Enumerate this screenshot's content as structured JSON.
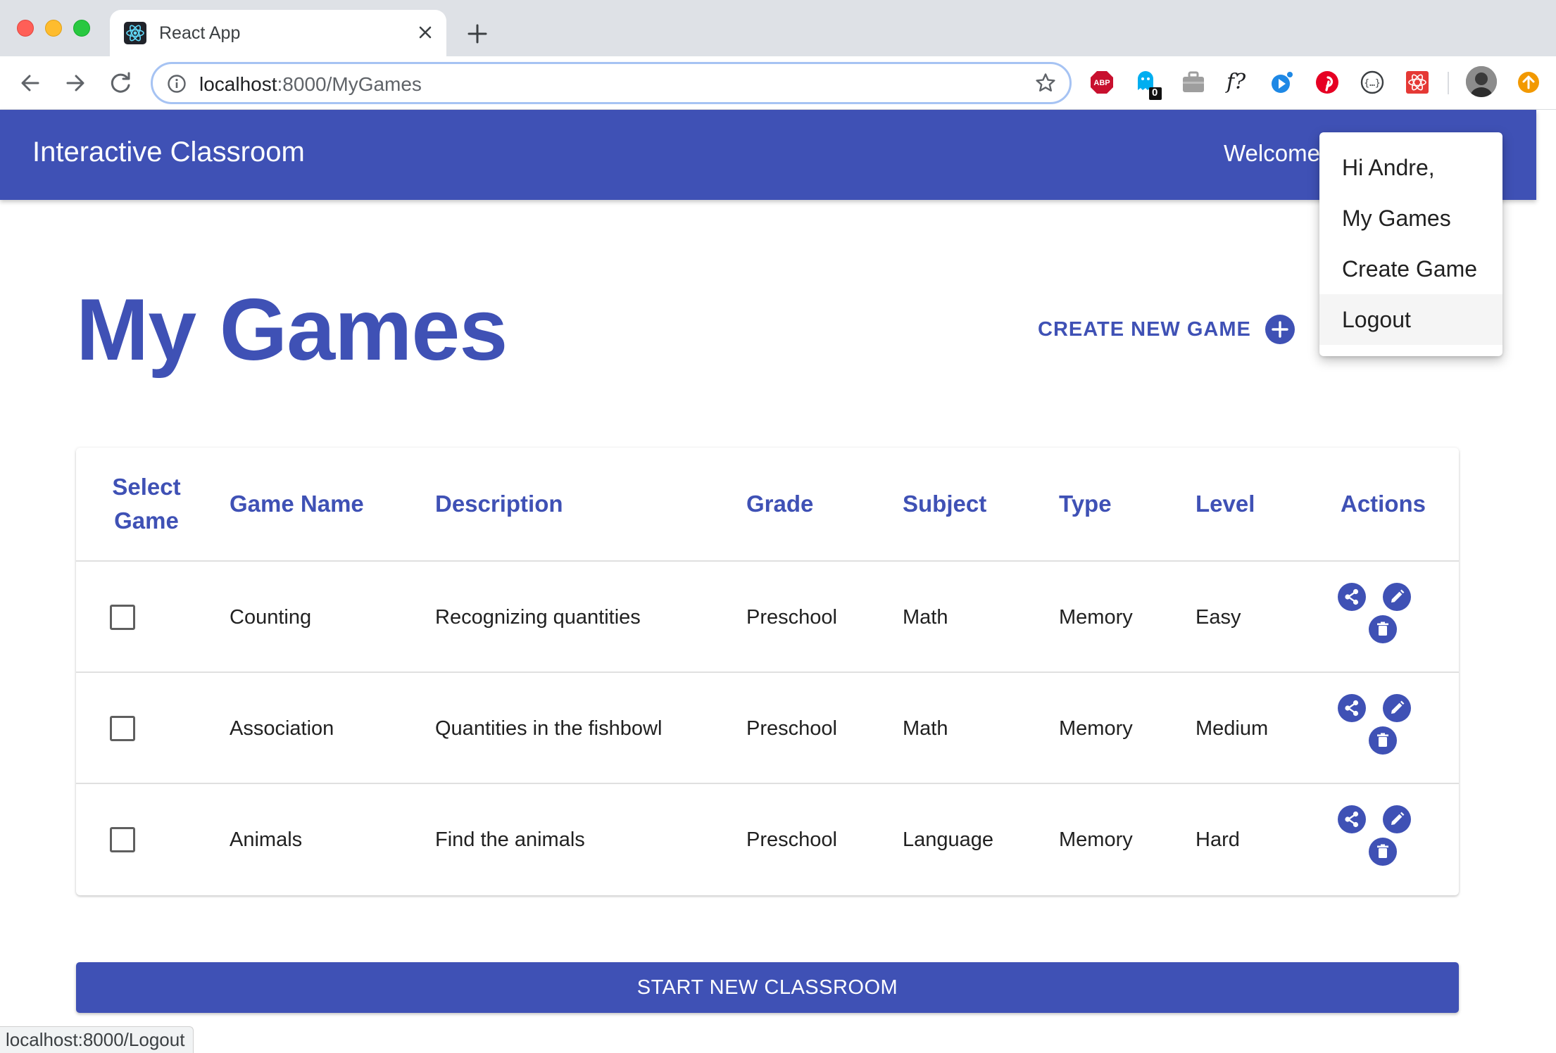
{
  "browser": {
    "tab_title": "React App",
    "url_host": "localhost",
    "url_path": ":8000/MyGames",
    "status_url": "localhost:8000/Logout",
    "badge_count": "0"
  },
  "appbar": {
    "title": "Interactive Classroom",
    "welcome": "Welcome"
  },
  "page": {
    "title": "My Games",
    "create_label": "CREATE NEW GAME"
  },
  "table": {
    "headers": {
      "select_line1": "Select",
      "select_line2": "Game",
      "name": "Game Name",
      "description": "Description",
      "grade": "Grade",
      "subject": "Subject",
      "type": "Type",
      "level": "Level",
      "actions": "Actions"
    },
    "rows": [
      {
        "name": "Counting",
        "description": "Recognizing quantities",
        "grade": "Preschool",
        "subject": "Math",
        "type": "Memory",
        "level": "Easy"
      },
      {
        "name": "Association",
        "description": "Quantities in the fishbowl",
        "grade": "Preschool",
        "subject": "Math",
        "type": "Memory",
        "level": "Medium"
      },
      {
        "name": "Animals",
        "description": "Find the animals",
        "grade": "Preschool",
        "subject": "Language",
        "type": "Memory",
        "level": "Hard"
      }
    ]
  },
  "start_button": "START NEW CLASSROOM",
  "menu": {
    "greeting": "Hi Andre,",
    "items": [
      "My Games",
      "Create Game",
      "Logout"
    ]
  },
  "colors": {
    "primary": "#3f51b5",
    "menu_hover": "#f5f5f5"
  },
  "icons": {
    "share": "share-icon",
    "edit": "edit-icon",
    "delete": "delete-icon",
    "add": "add-circle-icon"
  }
}
